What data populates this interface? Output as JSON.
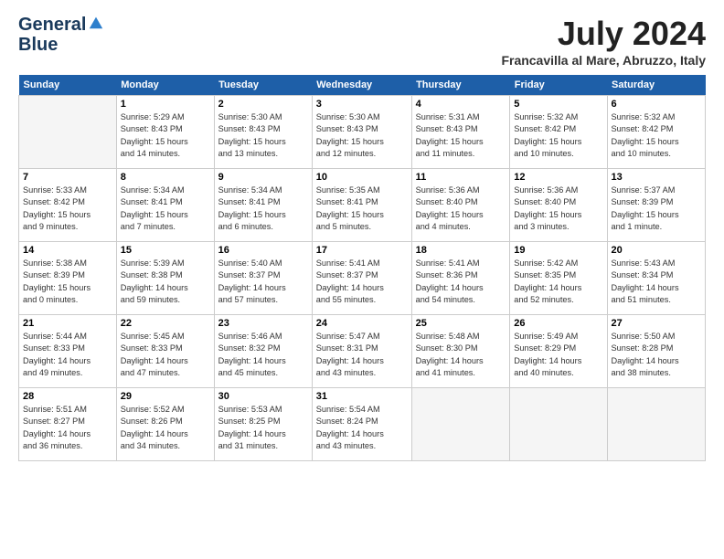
{
  "header": {
    "logo_line1": "General",
    "logo_line2": "Blue",
    "month": "July 2024",
    "location": "Francavilla al Mare, Abruzzo, Italy"
  },
  "columns": [
    "Sunday",
    "Monday",
    "Tuesday",
    "Wednesday",
    "Thursday",
    "Friday",
    "Saturday"
  ],
  "weeks": [
    [
      {
        "num": "",
        "info": ""
      },
      {
        "num": "1",
        "info": "Sunrise: 5:29 AM\nSunset: 8:43 PM\nDaylight: 15 hours\nand 14 minutes."
      },
      {
        "num": "2",
        "info": "Sunrise: 5:30 AM\nSunset: 8:43 PM\nDaylight: 15 hours\nand 13 minutes."
      },
      {
        "num": "3",
        "info": "Sunrise: 5:30 AM\nSunset: 8:43 PM\nDaylight: 15 hours\nand 12 minutes."
      },
      {
        "num": "4",
        "info": "Sunrise: 5:31 AM\nSunset: 8:43 PM\nDaylight: 15 hours\nand 11 minutes."
      },
      {
        "num": "5",
        "info": "Sunrise: 5:32 AM\nSunset: 8:42 PM\nDaylight: 15 hours\nand 10 minutes."
      },
      {
        "num": "6",
        "info": "Sunrise: 5:32 AM\nSunset: 8:42 PM\nDaylight: 15 hours\nand 10 minutes."
      }
    ],
    [
      {
        "num": "7",
        "info": "Sunrise: 5:33 AM\nSunset: 8:42 PM\nDaylight: 15 hours\nand 9 minutes."
      },
      {
        "num": "8",
        "info": "Sunrise: 5:34 AM\nSunset: 8:41 PM\nDaylight: 15 hours\nand 7 minutes."
      },
      {
        "num": "9",
        "info": "Sunrise: 5:34 AM\nSunset: 8:41 PM\nDaylight: 15 hours\nand 6 minutes."
      },
      {
        "num": "10",
        "info": "Sunrise: 5:35 AM\nSunset: 8:41 PM\nDaylight: 15 hours\nand 5 minutes."
      },
      {
        "num": "11",
        "info": "Sunrise: 5:36 AM\nSunset: 8:40 PM\nDaylight: 15 hours\nand 4 minutes."
      },
      {
        "num": "12",
        "info": "Sunrise: 5:36 AM\nSunset: 8:40 PM\nDaylight: 15 hours\nand 3 minutes."
      },
      {
        "num": "13",
        "info": "Sunrise: 5:37 AM\nSunset: 8:39 PM\nDaylight: 15 hours\nand 1 minute."
      }
    ],
    [
      {
        "num": "14",
        "info": "Sunrise: 5:38 AM\nSunset: 8:39 PM\nDaylight: 15 hours\nand 0 minutes."
      },
      {
        "num": "15",
        "info": "Sunrise: 5:39 AM\nSunset: 8:38 PM\nDaylight: 14 hours\nand 59 minutes."
      },
      {
        "num": "16",
        "info": "Sunrise: 5:40 AM\nSunset: 8:37 PM\nDaylight: 14 hours\nand 57 minutes."
      },
      {
        "num": "17",
        "info": "Sunrise: 5:41 AM\nSunset: 8:37 PM\nDaylight: 14 hours\nand 55 minutes."
      },
      {
        "num": "18",
        "info": "Sunrise: 5:41 AM\nSunset: 8:36 PM\nDaylight: 14 hours\nand 54 minutes."
      },
      {
        "num": "19",
        "info": "Sunrise: 5:42 AM\nSunset: 8:35 PM\nDaylight: 14 hours\nand 52 minutes."
      },
      {
        "num": "20",
        "info": "Sunrise: 5:43 AM\nSunset: 8:34 PM\nDaylight: 14 hours\nand 51 minutes."
      }
    ],
    [
      {
        "num": "21",
        "info": "Sunrise: 5:44 AM\nSunset: 8:33 PM\nDaylight: 14 hours\nand 49 minutes."
      },
      {
        "num": "22",
        "info": "Sunrise: 5:45 AM\nSunset: 8:33 PM\nDaylight: 14 hours\nand 47 minutes."
      },
      {
        "num": "23",
        "info": "Sunrise: 5:46 AM\nSunset: 8:32 PM\nDaylight: 14 hours\nand 45 minutes."
      },
      {
        "num": "24",
        "info": "Sunrise: 5:47 AM\nSunset: 8:31 PM\nDaylight: 14 hours\nand 43 minutes."
      },
      {
        "num": "25",
        "info": "Sunrise: 5:48 AM\nSunset: 8:30 PM\nDaylight: 14 hours\nand 41 minutes."
      },
      {
        "num": "26",
        "info": "Sunrise: 5:49 AM\nSunset: 8:29 PM\nDaylight: 14 hours\nand 40 minutes."
      },
      {
        "num": "27",
        "info": "Sunrise: 5:50 AM\nSunset: 8:28 PM\nDaylight: 14 hours\nand 38 minutes."
      }
    ],
    [
      {
        "num": "28",
        "info": "Sunrise: 5:51 AM\nSunset: 8:27 PM\nDaylight: 14 hours\nand 36 minutes."
      },
      {
        "num": "29",
        "info": "Sunrise: 5:52 AM\nSunset: 8:26 PM\nDaylight: 14 hours\nand 34 minutes."
      },
      {
        "num": "30",
        "info": "Sunrise: 5:53 AM\nSunset: 8:25 PM\nDaylight: 14 hours\nand 31 minutes."
      },
      {
        "num": "31",
        "info": "Sunrise: 5:54 AM\nSunset: 8:24 PM\nDaylight: 14 hours\nand 43 minutes."
      },
      {
        "num": "",
        "info": ""
      },
      {
        "num": "",
        "info": ""
      },
      {
        "num": "",
        "info": ""
      }
    ]
  ]
}
